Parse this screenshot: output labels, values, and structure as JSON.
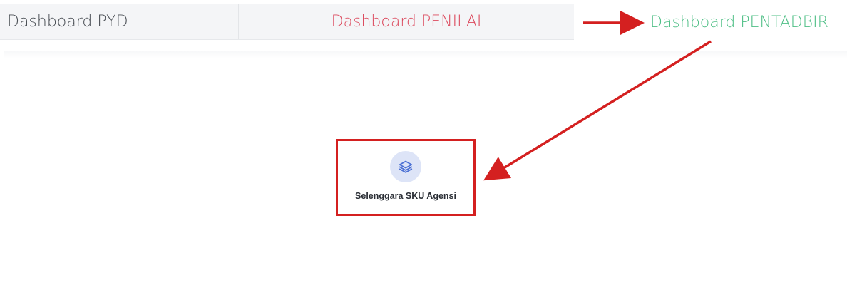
{
  "tabs": {
    "pyd": {
      "label": "Dashboard PYD",
      "color": "#4a4f55"
    },
    "penilai": {
      "label": "Dashboard PENILAI",
      "color": "#dc4a5e"
    },
    "pentadbir": {
      "label": "Dashboard PENTADBIR",
      "color": "#4fbf86"
    }
  },
  "tiles": [
    {
      "label": "Selenggara SKU Agensi",
      "icon": "layers-icon"
    }
  ],
  "colors": {
    "annotation": "#d42020",
    "icon_bg": "#dde4f7",
    "icon_fg": "#4a6fd4"
  }
}
